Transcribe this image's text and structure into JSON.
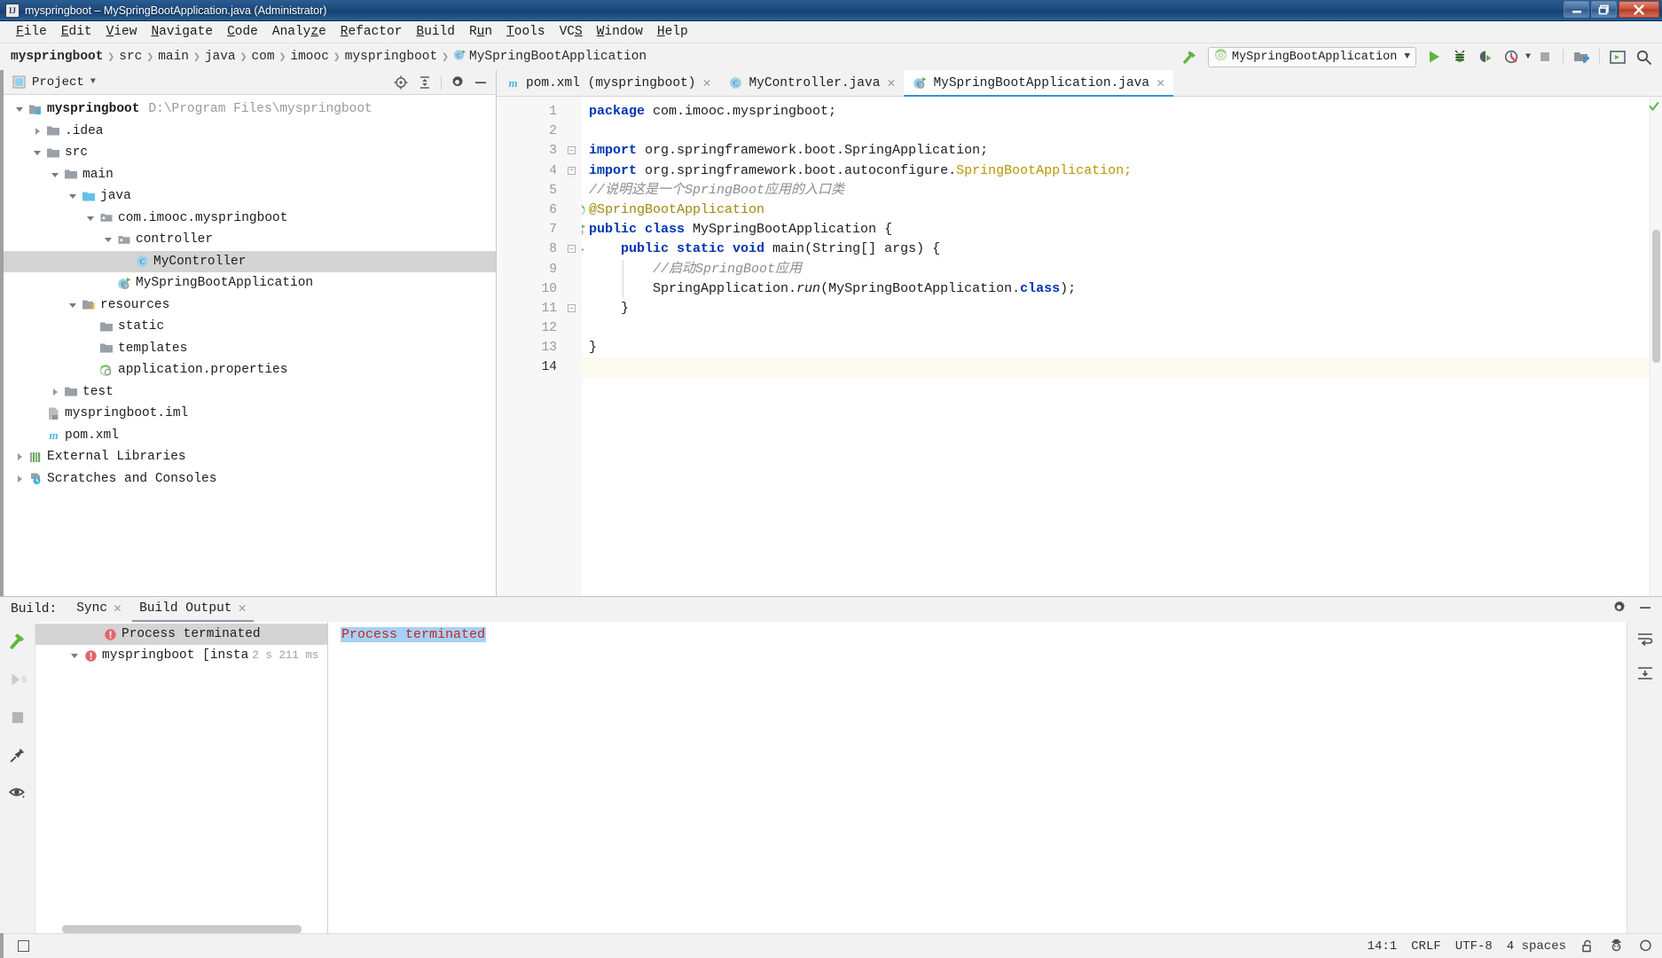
{
  "window": {
    "title": "myspringboot – MySpringBootApplication.java (Administrator)",
    "app_icon": "IJ",
    "minimize_label": "Minimize",
    "maximize_label": "Restore",
    "close_label": "Close"
  },
  "menubar": {
    "items": [
      {
        "label": "File",
        "mnemonic": "F"
      },
      {
        "label": "Edit",
        "mnemonic": "E"
      },
      {
        "label": "View",
        "mnemonic": "V"
      },
      {
        "label": "Navigate",
        "mnemonic": "N"
      },
      {
        "label": "Code",
        "mnemonic": "C"
      },
      {
        "label": "Analyze",
        "mnemonic": "z"
      },
      {
        "label": "Refactor",
        "mnemonic": "R"
      },
      {
        "label": "Build",
        "mnemonic": "B"
      },
      {
        "label": "Run",
        "mnemonic": "u"
      },
      {
        "label": "Tools",
        "mnemonic": "T"
      },
      {
        "label": "VCS",
        "mnemonic": "S"
      },
      {
        "label": "Window",
        "mnemonic": "W"
      },
      {
        "label": "Help",
        "mnemonic": "H"
      }
    ]
  },
  "breadcrumb": {
    "separator": "❯",
    "items": [
      {
        "label": "myspringboot",
        "bold": true,
        "icon": null
      },
      {
        "label": "src",
        "bold": false,
        "icon": null
      },
      {
        "label": "main",
        "bold": false,
        "icon": null
      },
      {
        "label": "java",
        "bold": false,
        "icon": null
      },
      {
        "label": "com",
        "bold": false,
        "icon": null
      },
      {
        "label": "imooc",
        "bold": false,
        "icon": null
      },
      {
        "label": "myspringboot",
        "bold": false,
        "icon": null
      },
      {
        "label": "MySpringBootApplication",
        "bold": false,
        "icon": "spring-class-icon"
      }
    ]
  },
  "toolbar": {
    "build_hammer_label": "Build Project",
    "run_config_name": "MySpringBootApplication",
    "run_config_icon": "spring-boot-icon",
    "run_config_caret": "▼",
    "run_label": "Run",
    "debug_label": "Debug",
    "run_coverage_label": "Run with Coverage",
    "profiler_label": "Profiler",
    "profiler_caret": "▼",
    "stop_label": "Stop",
    "project_structure_label": "Project Structure",
    "updating_label": "Run Anything",
    "search_label": "Search Everywhere"
  },
  "project_panel": {
    "title": "Project",
    "caret": "▼",
    "locate_label": "Select Opened File",
    "collapse_label": "Collapse All",
    "settings_label": "Settings",
    "hide_label": "Hide",
    "tree": [
      {
        "depth": 0,
        "label": "myspringboot",
        "path": "D:\\Program Files\\myspringboot",
        "arrow": "down",
        "icon": "module-folder-icon",
        "bold": true,
        "selected": false
      },
      {
        "depth": 1,
        "label": ".idea",
        "path": "",
        "arrow": "right",
        "icon": "folder-icon",
        "bold": false,
        "selected": false
      },
      {
        "depth": 1,
        "label": "src",
        "path": "",
        "arrow": "down",
        "icon": "folder-icon",
        "bold": false,
        "selected": false
      },
      {
        "depth": 2,
        "label": "main",
        "path": "",
        "arrow": "down",
        "icon": "folder-icon",
        "bold": false,
        "selected": false
      },
      {
        "depth": 3,
        "label": "java",
        "path": "",
        "arrow": "down",
        "icon": "source-folder-icon",
        "bold": false,
        "selected": false
      },
      {
        "depth": 4,
        "label": "com.imooc.myspringboot",
        "path": "",
        "arrow": "down",
        "icon": "package-icon",
        "bold": false,
        "selected": false
      },
      {
        "depth": 5,
        "label": "controller",
        "path": "",
        "arrow": "down",
        "icon": "package-icon",
        "bold": false,
        "selected": false
      },
      {
        "depth": 6,
        "label": "MyController",
        "path": "",
        "arrow": "none",
        "icon": "java-class-icon",
        "bold": false,
        "selected": true
      },
      {
        "depth": 5,
        "label": "MySpringBootApplication",
        "path": "",
        "arrow": "none",
        "icon": "spring-class-icon",
        "bold": false,
        "selected": false
      },
      {
        "depth": 3,
        "label": "resources",
        "path": "",
        "arrow": "down",
        "icon": "resources-folder-icon",
        "bold": false,
        "selected": false
      },
      {
        "depth": 4,
        "label": "static",
        "path": "",
        "arrow": "none",
        "icon": "folder-icon",
        "bold": false,
        "selected": false
      },
      {
        "depth": 4,
        "label": "templates",
        "path": "",
        "arrow": "none",
        "icon": "folder-icon",
        "bold": false,
        "selected": false
      },
      {
        "depth": 4,
        "label": "application.properties",
        "path": "",
        "arrow": "none",
        "icon": "spring-properties-icon",
        "bold": false,
        "selected": false
      },
      {
        "depth": 2,
        "label": "test",
        "path": "",
        "arrow": "right",
        "icon": "folder-icon",
        "bold": false,
        "selected": false
      },
      {
        "depth": 1,
        "label": "myspringboot.iml",
        "path": "",
        "arrow": "none",
        "icon": "iml-file-icon",
        "bold": false,
        "selected": false
      },
      {
        "depth": 1,
        "label": "pom.xml",
        "path": "",
        "arrow": "none",
        "icon": "maven-icon",
        "bold": false,
        "selected": false
      },
      {
        "depth": 0,
        "label": "External Libraries",
        "path": "",
        "arrow": "right",
        "icon": "libraries-icon",
        "bold": false,
        "selected": false
      },
      {
        "depth": 0,
        "label": "Scratches and Consoles",
        "path": "",
        "arrow": "right",
        "icon": "scratches-icon",
        "bold": false,
        "selected": false
      }
    ]
  },
  "editor": {
    "tabs": [
      {
        "label": "pom.xml (myspringboot)",
        "icon": "maven-icon",
        "active": false,
        "close": "✕"
      },
      {
        "label": "MyController.java",
        "icon": "java-class-icon",
        "active": false,
        "close": "✕"
      },
      {
        "label": "MySpringBootApplication.java",
        "icon": "spring-class-icon",
        "active": true,
        "close": "✕"
      }
    ],
    "line_numbers": [
      "1",
      "2",
      "3",
      "4",
      "5",
      "6",
      "7",
      "8",
      "9",
      "10",
      "11",
      "12",
      "13",
      "14"
    ],
    "current_line": 14,
    "inspection_status": "ok",
    "lines": [
      {
        "n": 1,
        "tokens": [
          {
            "t": "package ",
            "c": "kw"
          },
          {
            "t": "com.imooc.myspringboot;",
            "c": "plain"
          }
        ],
        "indent": 0
      },
      {
        "n": 2,
        "tokens": [],
        "indent": 0
      },
      {
        "n": 3,
        "tokens": [
          {
            "t": "import ",
            "c": "kw"
          },
          {
            "t": "org.springframework.boot.SpringApplication;",
            "c": "plain"
          }
        ],
        "indent": 0
      },
      {
        "n": 4,
        "tokens": [
          {
            "t": "import ",
            "c": "kw"
          },
          {
            "t": "org.springframework.boot.autoconfigure.",
            "c": "plain"
          },
          {
            "t": "SpringBootApplication;",
            "c": "cls"
          }
        ],
        "indent": 0
      },
      {
        "n": 5,
        "tokens": [
          {
            "t": "//说明这是一个SpringBoot应用的入口类",
            "c": "cmt"
          }
        ],
        "indent": 0
      },
      {
        "n": 6,
        "tokens": [
          {
            "t": "@SpringBootApplication",
            "c": "ann"
          }
        ],
        "indent": 0
      },
      {
        "n": 7,
        "tokens": [
          {
            "t": "public class ",
            "c": "kw"
          },
          {
            "t": "MySpringBootApplication {",
            "c": "plain"
          }
        ],
        "indent": 0
      },
      {
        "n": 8,
        "tokens": [
          {
            "t": "    ",
            "c": "plain"
          },
          {
            "t": "public static void ",
            "c": "kw"
          },
          {
            "t": "main",
            "c": "plain"
          },
          {
            "t": "(String[] args) {",
            "c": "plain"
          }
        ],
        "indent": 1
      },
      {
        "n": 9,
        "tokens": [
          {
            "t": "        ",
            "c": "plain"
          },
          {
            "t": "//启动SpringBoot应用",
            "c": "cmt"
          }
        ],
        "indent": 2
      },
      {
        "n": 10,
        "tokens": [
          {
            "t": "        SpringApplication.",
            "c": "plain"
          },
          {
            "t": "run",
            "c": "ital"
          },
          {
            "t": "(MySpringBootApplication.",
            "c": "plain"
          },
          {
            "t": "class",
            "c": "kw"
          },
          {
            "t": ");",
            "c": "plain"
          }
        ],
        "indent": 2
      },
      {
        "n": 11,
        "tokens": [
          {
            "t": "    }",
            "c": "plain"
          }
        ],
        "indent": 1
      },
      {
        "n": 12,
        "tokens": [],
        "indent": 0
      },
      {
        "n": 13,
        "tokens": [
          {
            "t": "}",
            "c": "plain"
          }
        ],
        "indent": 0
      },
      {
        "n": 14,
        "tokens": [],
        "indent": 0
      }
    ],
    "gutter_marks": [
      {
        "line": 6,
        "icon": "spring-bean-icon"
      },
      {
        "line": 7,
        "icon": "spring-run-icon"
      },
      {
        "line": 8,
        "icon": "run-arrow-icon"
      }
    ]
  },
  "build_panel": {
    "label": "Build:",
    "tabs": [
      {
        "label": "Sync",
        "active": false,
        "close": "✕"
      },
      {
        "label": "Build Output",
        "active": true,
        "close": "✕"
      }
    ],
    "settings_label": "Settings",
    "hide_label": "Hide",
    "rail_icons": [
      {
        "name": "build-hammer-icon",
        "label": "Build"
      },
      {
        "name": "rerun-icon",
        "label": "Rerun"
      },
      {
        "name": "stop-icon",
        "label": "Stop"
      },
      {
        "name": "pin-icon",
        "label": "Pin Tab"
      },
      {
        "name": "eye-icon",
        "label": "Toggle View"
      }
    ],
    "right_icons": [
      {
        "name": "soft-wrap-icon",
        "label": "Soft-Wrap"
      },
      {
        "name": "scroll-end-icon",
        "label": "Scroll to End"
      }
    ],
    "tree": [
      {
        "depth": 0,
        "arrow": "down",
        "icon": "error-icon",
        "label": "myspringboot [insta",
        "time": "2 s 211 ms",
        "selected": false
      },
      {
        "depth": 1,
        "arrow": "none",
        "icon": "error-icon",
        "label": "Process terminated",
        "time": "",
        "selected": true
      }
    ],
    "console_text": "Process terminated"
  },
  "statusbar": {
    "caret_position": "14:1",
    "line_separator": "CRLF",
    "encoding": "UTF-8",
    "indent": "4 spaces",
    "lock_icon": "unlocked-icon",
    "inspection_icon": "hector-icon",
    "notification_icon": "notification-icon",
    "memory_icon": "editor-icon"
  }
}
